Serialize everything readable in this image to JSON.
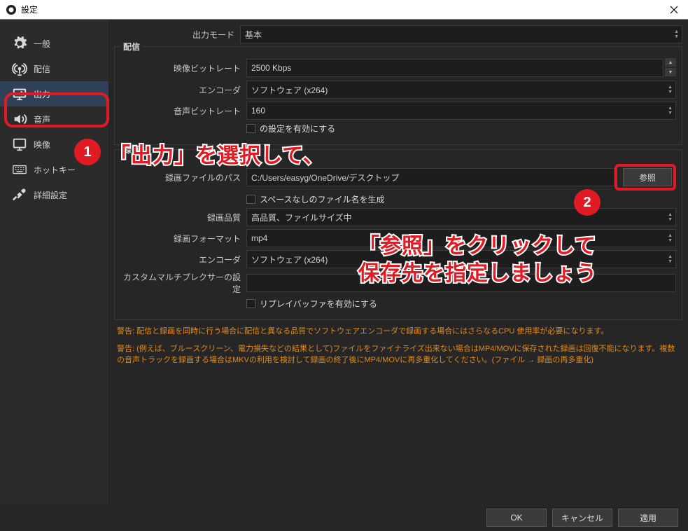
{
  "window": {
    "title": "設定"
  },
  "sidebar": {
    "items": [
      {
        "label": "一般"
      },
      {
        "label": "配信"
      },
      {
        "label": "出力"
      },
      {
        "label": "音声"
      },
      {
        "label": "映像"
      },
      {
        "label": "ホットキー"
      },
      {
        "label": "詳細設定"
      }
    ]
  },
  "output_mode": {
    "label": "出力モード",
    "value": "基本"
  },
  "streaming": {
    "title": "配信",
    "bitrate_label": "映像ビットレート",
    "bitrate_value": "2500 Kbps",
    "encoder_label": "エンコーダ",
    "encoder_value": "ソフトウェア (x264)",
    "audio_bitrate_label": "音声ビットレート",
    "audio_bitrate_value": "160",
    "advanced_checkbox": "の設定を有効にする"
  },
  "recording": {
    "title": "録画",
    "path_label": "録画ファイルのパス",
    "path_value": "C:/Users/easyg/OneDrive/デスクトップ",
    "browse_label": "参照",
    "nospace_label": "スペースなしのファイル名を生成",
    "quality_label": "録画品質",
    "quality_value": "高品質、ファイルサイズ中",
    "format_label": "録画フォーマット",
    "format_value": "mp4",
    "encoder_label": "エンコーダ",
    "encoder_value": "ソフトウェア (x264)",
    "muxer_label": "カスタムマルチプレクサーの設定",
    "muxer_value": "",
    "replay_label": "リプレイバッファを有効にする"
  },
  "warnings": {
    "w1": "警告: 配信と録画を同時に行う場合に配信と異なる品質でソフトウェアエンコーダで録画する場合にはさらなるCPU 使用率が必要になります。",
    "w2": "警告: (例えば、ブルースクリーン、電力損失などの結果として)ファイルをファイナライズ出来ない場合はMP4/MOVに保存された録画は回復不能になります。複数の音声トラックを録画する場合はMKVの利用を検討して録画の終了後にMP4/MOVに再多重化してください。(ファイル → 録画の再多重化)"
  },
  "footer": {
    "ok": "OK",
    "cancel": "キャンセル",
    "apply": "適用"
  },
  "annotations": {
    "badge1": "1",
    "badge2": "2",
    "callout1": "「出力」を選択して、",
    "callout2a": "「参照」をクリックして",
    "callout2b": "保存先を指定しましょう"
  }
}
